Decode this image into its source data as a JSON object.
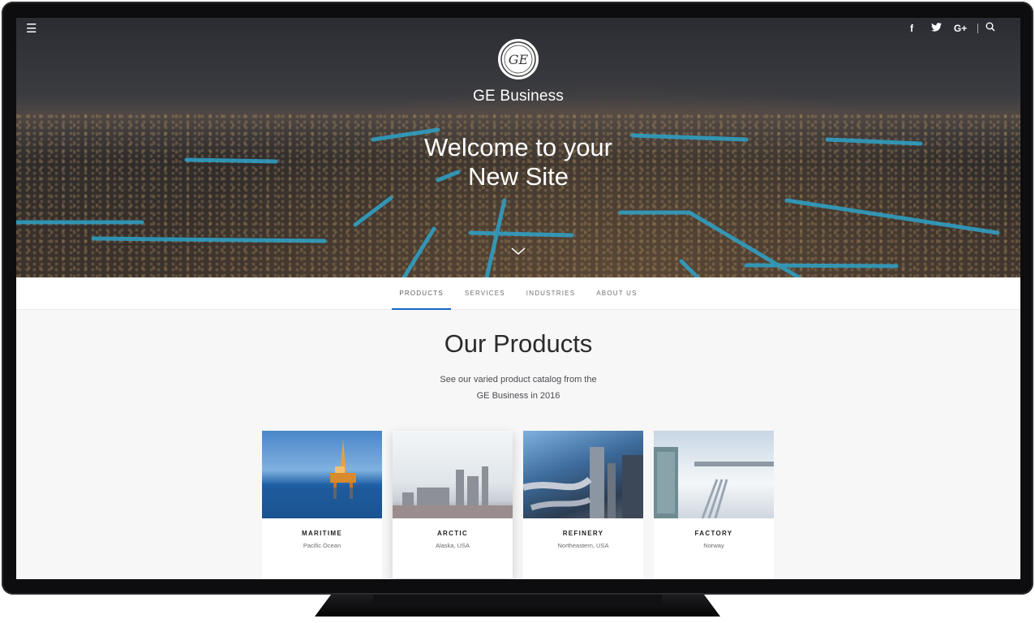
{
  "header": {
    "brand": "GE Business",
    "headline_line1": "Welcome to your",
    "headline_line2": "New Site",
    "icons": [
      "menu-icon",
      "facebook-icon",
      "twitter-icon",
      "google-plus-icon",
      "search-icon"
    ],
    "social_labels": {
      "facebook": "f",
      "google_plus": "G+"
    }
  },
  "nav": {
    "tabs": [
      {
        "label": "PRODUCTS",
        "active": true
      },
      {
        "label": "SERVICES",
        "active": false
      },
      {
        "label": "INDUSTRIES",
        "active": false
      },
      {
        "label": "ABOUT US",
        "active": false
      }
    ]
  },
  "products": {
    "title": "Our Products",
    "subtitle_line1": "See our varied product catalog from the",
    "subtitle_line2": "GE Business in 2016",
    "cards": [
      {
        "name": "MARITIME",
        "location": "Pacific Ocean"
      },
      {
        "name": "ARCTIC",
        "location": "Alaska, USA"
      },
      {
        "name": "REFINERY",
        "location": "Northeastern, USA"
      },
      {
        "name": "FACTORY",
        "location": "Norway"
      }
    ]
  },
  "colors": {
    "accent": "#1565c0",
    "hero_lines": "#2ea3c9",
    "text_dark": "#2b2b2d"
  }
}
